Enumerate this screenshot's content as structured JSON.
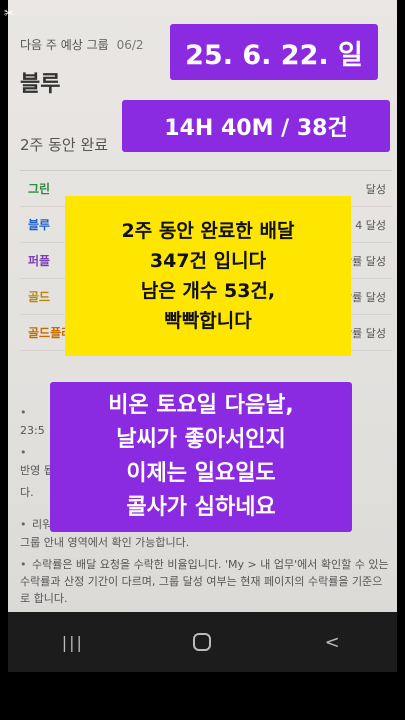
{
  "app": {
    "header_text": "다음 주 예상 그룹",
    "header_date": "06/2",
    "page_title": "블루",
    "section_title": "2주 동안 완료"
  },
  "grades": [
    {
      "name": "그린",
      "status": "달성",
      "color": "#2d8a3e"
    },
    {
      "name": "블루",
      "status": "4 달성",
      "color": "#1d5fc9"
    },
    {
      "name": "퍼플",
      "status": "수락률 달성",
      "color": "#7b3fb5"
    },
    {
      "name": "골드",
      "status": "남음 · 수락률 달성",
      "color": "#b8860b"
    },
    {
      "name": "골드플러스",
      "status": "53건 남음 · 수락률 달성",
      "color": "#c76b00"
    }
  ],
  "notes": [
    {
      "text": "4",
      "prefix": "23:5"
    },
    {
      "text": "반영 됩니다.",
      "suffix": "요합니다"
    },
    {
      "text": "다."
    },
    {
      "text": "리워",
      "suffix": "그룹 안내 영역에서 확인 가능합니다."
    },
    {
      "text": "수락률은 배달 요청을 수락한 비율입니다. 'My > 내 업무'에서 확인할 수 있는 수락률과 산정 기간이 다르며, 그룹 달성 여부는 현재 페이지의 수락률을 기준으로 합니다."
    }
  ],
  "overlay": {
    "date": "25. 6. 22. 일",
    "time": "14H 40M / 38건",
    "yellow": [
      "2주 동안 완료한 배달",
      "347건 입니다",
      "남은 개수 53건,",
      "빡빡합니다"
    ],
    "bottom": [
      "비온 토요일 다음날,",
      "날씨가 좋아서인지",
      "이제는 일요일도",
      "콜사가 심하네요"
    ]
  },
  "nav": {
    "recent": "|||",
    "back": "<"
  },
  "colors": {
    "overlay_purple": "#8a2be2",
    "overlay_yellow": "#ffe600"
  }
}
